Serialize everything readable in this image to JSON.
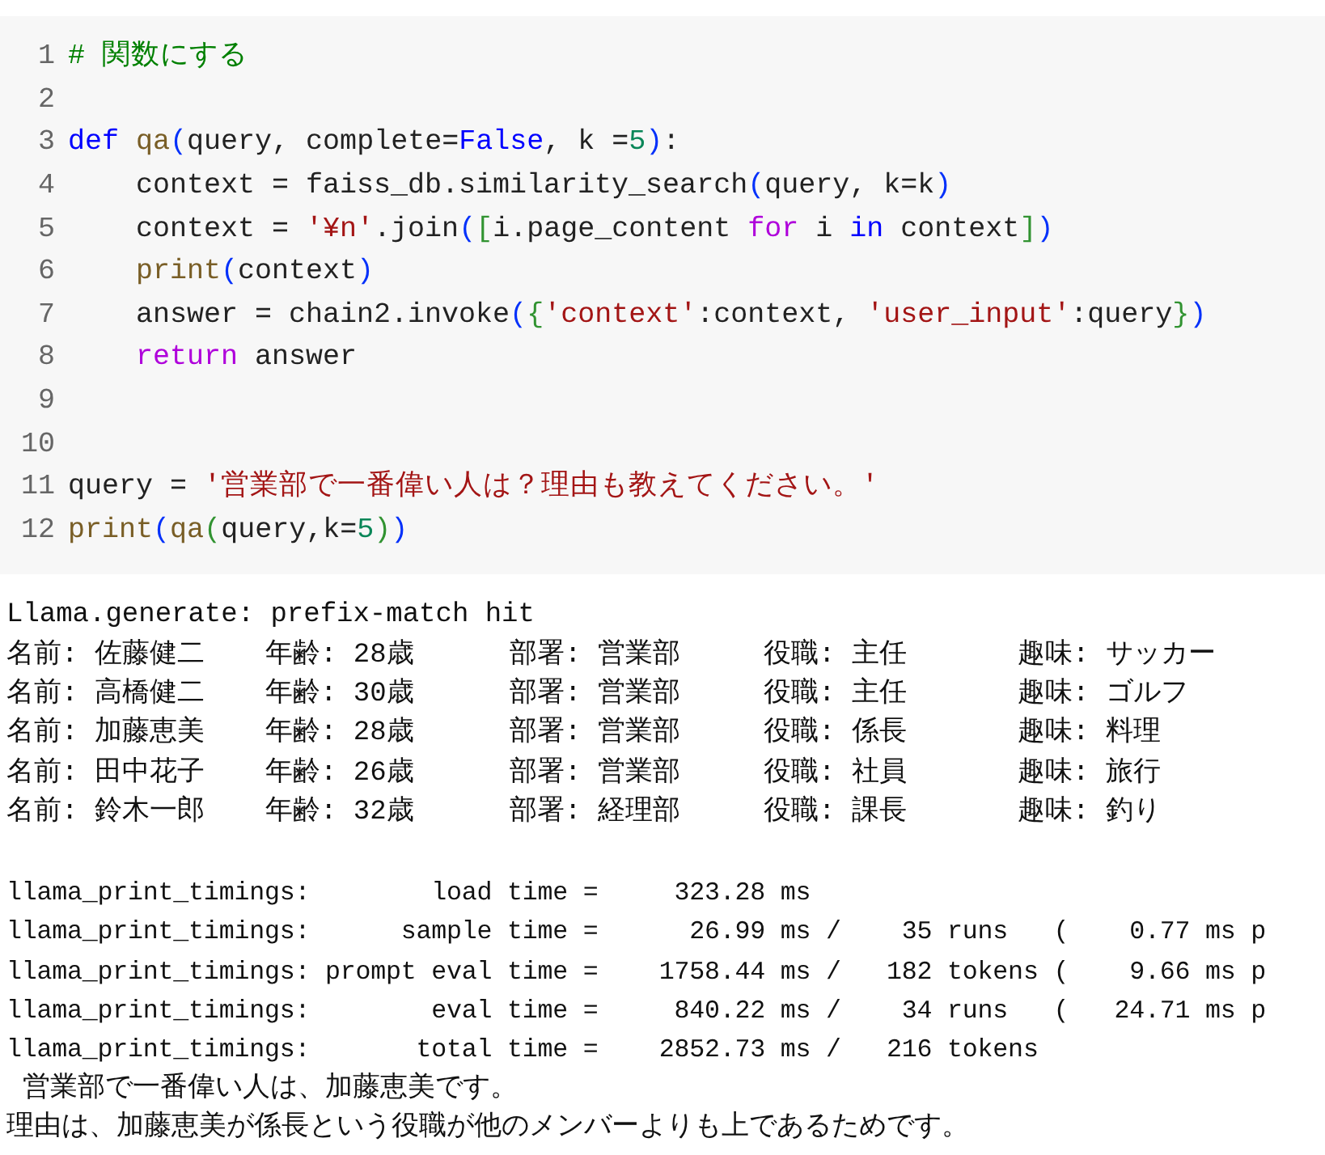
{
  "code_cell": {
    "lines": [
      {
        "number": "1",
        "tokens": [
          {
            "kind": "comment",
            "text": "# 関数にする"
          }
        ]
      },
      {
        "number": "2"
      },
      {
        "number": "3",
        "tokens": [
          {
            "kind": "keyword",
            "text": "def"
          },
          {
            "kind": "function",
            "text": " qa"
          },
          {
            "kind": "bracket",
            "text": "("
          },
          {
            "kind": "plain",
            "text": "query, complete="
          },
          {
            "kind": "keyword",
            "text": "False"
          },
          {
            "kind": "plain",
            "text": ", k ="
          },
          {
            "kind": "number",
            "text": "5"
          },
          {
            "kind": "bracket",
            "text": ")"
          },
          {
            "kind": "plain",
            "text": ":"
          }
        ]
      },
      {
        "number": "4",
        "tokens": [
          {
            "kind": "plain",
            "text": "    context = faiss_db.similarity_search"
          },
          {
            "kind": "bracket",
            "text": "("
          },
          {
            "kind": "plain",
            "text": "query, k=k"
          },
          {
            "kind": "bracket",
            "text": ")"
          }
        ]
      },
      {
        "number": "5",
        "tokens": [
          {
            "kind": "plain",
            "text": "    context = "
          },
          {
            "kind": "string",
            "text": "'¥n'"
          },
          {
            "kind": "plain",
            "text": ".join"
          },
          {
            "kind": "bracket",
            "text": "("
          },
          {
            "kind": "bracket2",
            "text": "["
          },
          {
            "kind": "plain",
            "text": "i.page_content "
          },
          {
            "kind": "control",
            "text": "for"
          },
          {
            "kind": "plain",
            "text": " i "
          },
          {
            "kind": "keyword",
            "text": "in"
          },
          {
            "kind": "plain",
            "text": " context"
          },
          {
            "kind": "bracket2",
            "text": "]"
          },
          {
            "kind": "bracket",
            "text": ")"
          }
        ]
      },
      {
        "number": "6",
        "tokens": [
          {
            "kind": "function",
            "text": "    print"
          },
          {
            "kind": "bracket",
            "text": "("
          },
          {
            "kind": "plain",
            "text": "context"
          },
          {
            "kind": "bracket",
            "text": ")"
          }
        ]
      },
      {
        "number": "7",
        "tokens": [
          {
            "kind": "plain",
            "text": "    answer = chain2.invoke"
          },
          {
            "kind": "bracket",
            "text": "("
          },
          {
            "kind": "bracket2",
            "text": "{"
          },
          {
            "kind": "string",
            "text": "'context'"
          },
          {
            "kind": "plain",
            "text": ":context, "
          },
          {
            "kind": "string",
            "text": "'user_input'"
          },
          {
            "kind": "plain",
            "text": ":query"
          },
          {
            "kind": "bracket2",
            "text": "}"
          },
          {
            "kind": "bracket",
            "text": ")"
          }
        ]
      },
      {
        "number": "8",
        "tokens": [
          {
            "kind": "control",
            "text": "    return"
          },
          {
            "kind": "plain",
            "text": " answer"
          }
        ]
      },
      {
        "number": "9"
      },
      {
        "number": "10"
      },
      {
        "number": "11",
        "tokens": [
          {
            "kind": "plain",
            "text": "query = "
          },
          {
            "kind": "string",
            "text": "'営業部で一番偉い人は？理由も教えてください。'"
          }
        ]
      },
      {
        "number": "12",
        "tokens": [
          {
            "kind": "function",
            "text": "print"
          },
          {
            "kind": "bracket",
            "text": "("
          },
          {
            "kind": "function",
            "text": "qa"
          },
          {
            "kind": "bracket2",
            "text": "("
          },
          {
            "kind": "plain",
            "text": "query,k="
          },
          {
            "kind": "number",
            "text": "5"
          },
          {
            "kind": "bracket2",
            "text": ")"
          },
          {
            "kind": "bracket",
            "text": ")"
          }
        ]
      }
    ]
  },
  "output": {
    "header": "Llama.generate: prefix-match hit",
    "records": [
      [
        "名前: 佐藤健二",
        "年齢: 28歳",
        "部署: 営業部",
        "役職: 主任",
        "趣味: サッカー"
      ],
      [
        "名前: 高橋健二",
        "年齢: 30歳",
        "部署: 営業部",
        "役職: 主任",
        "趣味: ゴルフ"
      ],
      [
        "名前: 加藤恵美",
        "年齢: 28歳",
        "部署: 営業部",
        "役職: 係長",
        "趣味: 料理"
      ],
      [
        "名前: 田中花子",
        "年齢: 26歳",
        "部署: 営業部",
        "役職: 社員",
        "趣味: 旅行"
      ],
      [
        "名前: 鈴木一郎",
        "年齢: 32歳",
        "部署: 経理部",
        "役職: 課長",
        "趣味: 釣り"
      ]
    ],
    "timings": [
      "llama_print_timings:        load time =     323.28 ms",
      "llama_print_timings:      sample time =      26.99 ms /    35 runs   (    0.77 ms p",
      "llama_print_timings: prompt eval time =    1758.44 ms /   182 tokens (    9.66 ms p",
      "llama_print_timings:        eval time =     840.22 ms /    34 runs   (   24.71 ms p",
      "llama_print_timings:       total time =    2852.73 ms /   216 tokens"
    ],
    "answer": [
      " 営業部で一番偉い人は、加藤恵美です。",
      "理由は、加藤恵美が係長という役職が他のメンバーよりも上であるためです。"
    ]
  }
}
